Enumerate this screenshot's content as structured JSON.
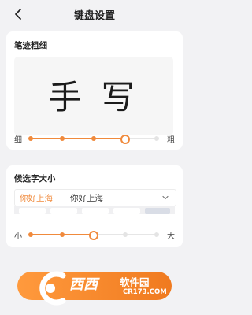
{
  "header": {
    "title": "键盘设置",
    "back_icon": "chevron-left-icon"
  },
  "stroke_section": {
    "title": "笔迹粗细",
    "preview_text": "手 写",
    "slider": {
      "min_label": "细",
      "max_label": "粗",
      "stops": 5,
      "selected_index": 3
    }
  },
  "candidate_section": {
    "title": "候选字大小",
    "candidates": [
      "你好上海",
      "你好上海"
    ],
    "expand_icon": "chevron-down-icon",
    "slider": {
      "min_label": "小",
      "max_label": "大",
      "stops": 5,
      "selected_index": 2
    }
  },
  "watermark": {
    "brand": "西西",
    "text": "软件园",
    "url": "CR173.COM"
  },
  "colors": {
    "accent": "#f08a3c",
    "background": "#f2f2f4",
    "card": "#ffffff"
  }
}
